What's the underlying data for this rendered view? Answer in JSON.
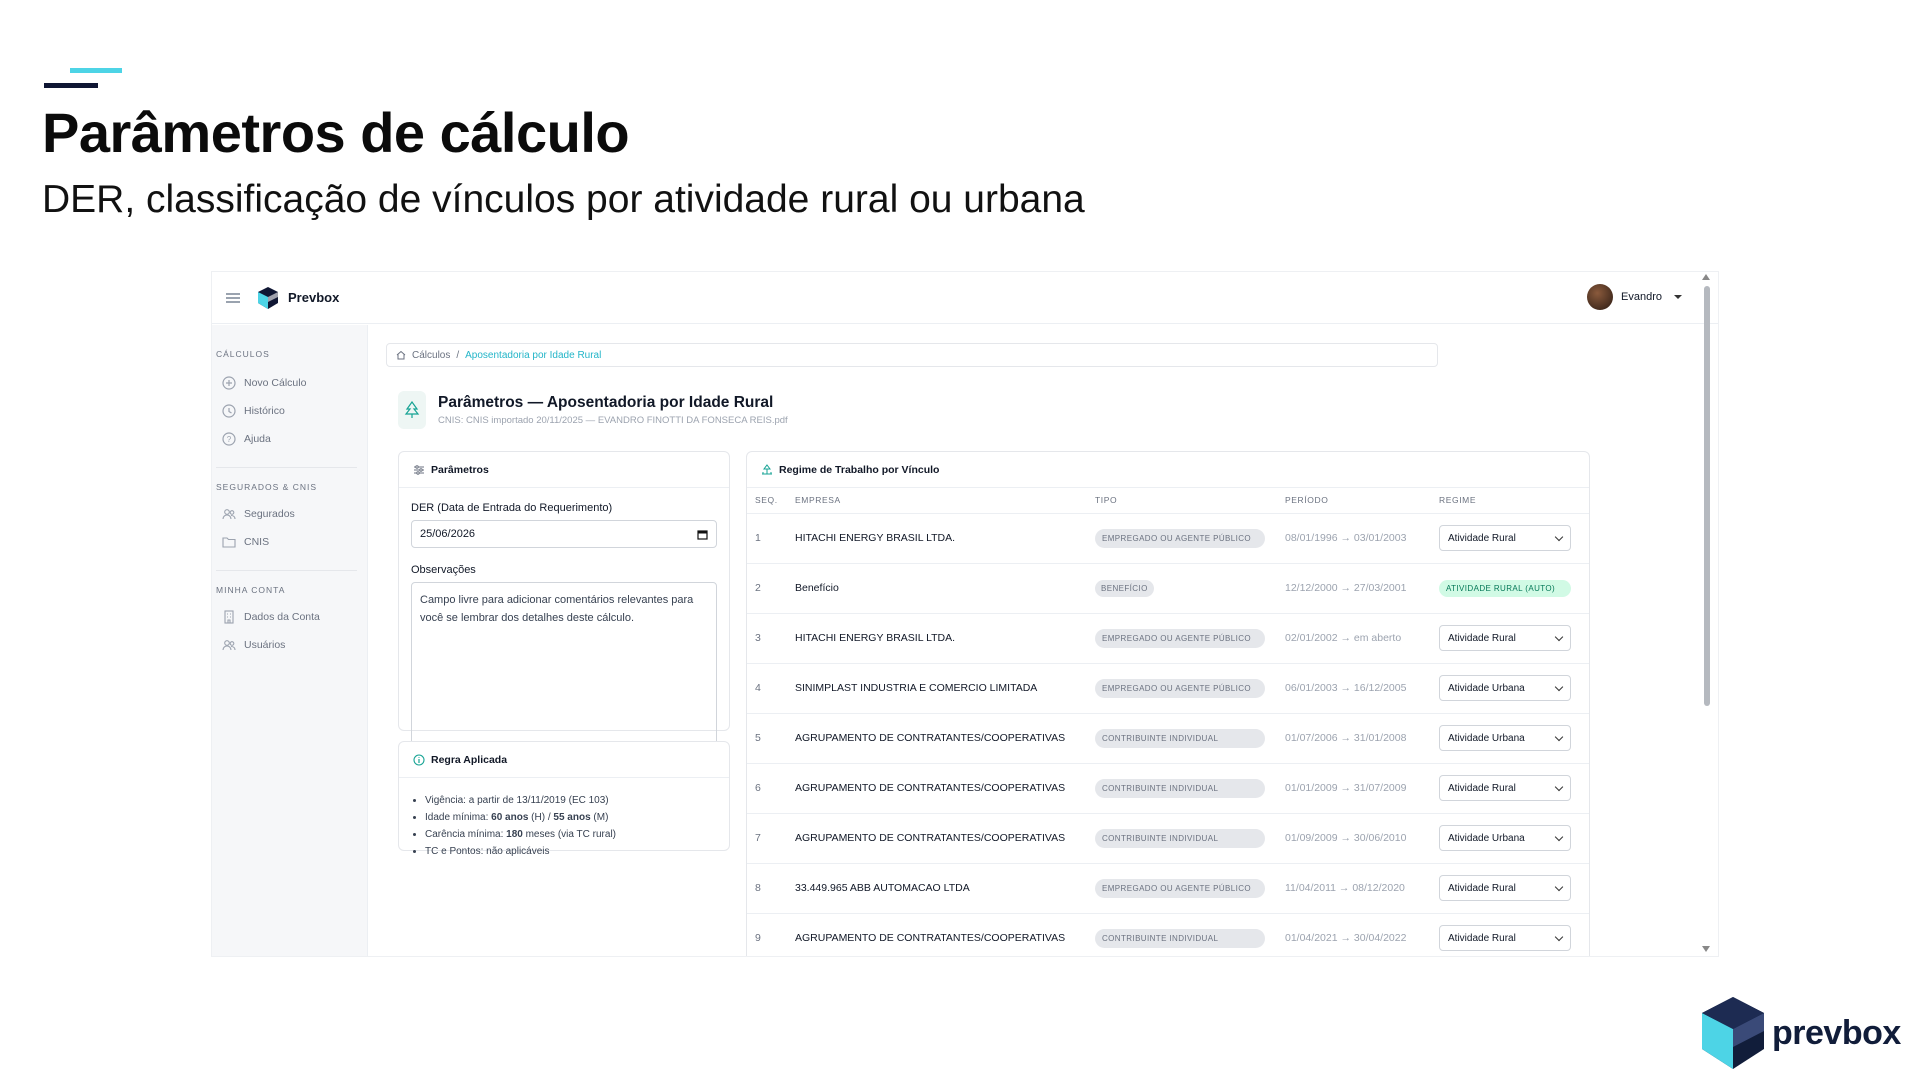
{
  "slide": {
    "title": "Parâmetros de cálculo",
    "subtitle": "DER, classificação de vínculos por atividade rural ou urbana",
    "logo_text": "prevbox"
  },
  "colors": {
    "accent": "#4dd4e6",
    "navy": "#0f1633",
    "teal_link": "#23b5c8",
    "auto_green_bg": "#d1fae5"
  },
  "app": {
    "brand": "Prevbox",
    "user": {
      "name": "Evandro"
    }
  },
  "sidebar": {
    "sections": [
      {
        "title": "CÁLCULOS",
        "items": [
          {
            "label": "Novo Cálculo",
            "icon": "plus-circle-icon"
          },
          {
            "label": "Histórico",
            "icon": "clock-icon"
          },
          {
            "label": "Ajuda",
            "icon": "help-icon"
          }
        ]
      },
      {
        "title": "SEGURADOS & CNIS",
        "items": [
          {
            "label": "Segurados",
            "icon": "users-icon"
          },
          {
            "label": "CNIS",
            "icon": "folder-icon"
          }
        ]
      },
      {
        "title": "MINHA CONTA",
        "items": [
          {
            "label": "Dados da Conta",
            "icon": "building-icon"
          },
          {
            "label": "Usuários",
            "icon": "users-icon"
          }
        ]
      }
    ]
  },
  "breadcrumb": {
    "root": "Cálculos",
    "separator": "/",
    "current": "Aposentadoria por Idade Rural"
  },
  "page": {
    "title": "Parâmetros — Aposentadoria por Idade Rural",
    "subtitle": "CNIS: CNIS importado 20/11/2025 — EVANDRO FINOTTI DA FONSECA REIS.pdf"
  },
  "params_card": {
    "title": "Parâmetros",
    "der_label": "DER (Data de Entrada do Requerimento)",
    "der_value": "25/06/2026",
    "obs_label": "Observações",
    "obs_placeholder": "Campo livre para adicionar comentários relevantes para você se lembrar dos detalhes deste cálculo."
  },
  "rule_card": {
    "title": "Regra Aplicada",
    "items": [
      {
        "prefix": "Vigência: a partir de 13/11/2019 (EC 103)",
        "strong1": "",
        "mid": "",
        "strong2": "",
        "suffix": ""
      },
      {
        "prefix": "Idade mínima: ",
        "strong1": "60 anos",
        "mid": " (H) / ",
        "strong2": "55 anos",
        "suffix": " (M)"
      },
      {
        "prefix": "Carência mínima: ",
        "strong1": "180",
        "mid": " meses (via TC rural)",
        "strong2": "",
        "suffix": ""
      },
      {
        "prefix": "TC e Pontos: não aplicáveis",
        "strong1": "",
        "mid": "",
        "strong2": "",
        "suffix": ""
      }
    ]
  },
  "vinculos": {
    "title": "Regime de Trabalho por Vínculo",
    "columns": [
      "SEQ.",
      "EMPRESA",
      "TIPO",
      "PERÍODO",
      "REGIME"
    ],
    "rows": [
      {
        "seq": "1",
        "empresa": "HITACHI ENERGY BRASIL LTDA.",
        "tipo": "EMPREGADO OU AGENTE PÚBLICO",
        "periodo": "08/01/1996 → 03/01/2003",
        "regime": "Atividade Rural",
        "auto": false
      },
      {
        "seq": "2",
        "empresa": "Benefício",
        "tipo": "BENEFÍCIO",
        "periodo": "12/12/2000 → 27/03/2001",
        "regime": "ATIVIDADE RURAL (AUTO)",
        "auto": true
      },
      {
        "seq": "3",
        "empresa": "HITACHI ENERGY BRASIL LTDA.",
        "tipo": "EMPREGADO OU AGENTE PÚBLICO",
        "periodo": "02/01/2002 → em aberto",
        "regime": "Atividade Rural",
        "auto": false
      },
      {
        "seq": "4",
        "empresa": "SINIMPLAST INDUSTRIA E COMERCIO LIMITADA",
        "tipo": "EMPREGADO OU AGENTE PÚBLICO",
        "periodo": "06/01/2003 → 16/12/2005",
        "regime": "Atividade Urbana",
        "auto": false
      },
      {
        "seq": "5",
        "empresa": "AGRUPAMENTO DE CONTRATANTES/COOPERATIVAS",
        "tipo": "CONTRIBUINTE INDIVIDUAL",
        "periodo": "01/07/2006 → 31/01/2008",
        "regime": "Atividade Urbana",
        "auto": false
      },
      {
        "seq": "6",
        "empresa": "AGRUPAMENTO DE CONTRATANTES/COOPERATIVAS",
        "tipo": "CONTRIBUINTE INDIVIDUAL",
        "periodo": "01/01/2009 → 31/07/2009",
        "regime": "Atividade Rural",
        "auto": false
      },
      {
        "seq": "7",
        "empresa": "AGRUPAMENTO DE CONTRATANTES/COOPERATIVAS",
        "tipo": "CONTRIBUINTE INDIVIDUAL",
        "periodo": "01/09/2009 → 30/06/2010",
        "regime": "Atividade Urbana",
        "auto": false
      },
      {
        "seq": "8",
        "empresa": "33.449.965 ABB AUTOMACAO LTDA",
        "tipo": "EMPREGADO OU AGENTE PÚBLICO",
        "periodo": "11/04/2011 → 08/12/2020",
        "regime": "Atividade Rural",
        "auto": false
      },
      {
        "seq": "9",
        "empresa": "AGRUPAMENTO DE CONTRATANTES/COOPERATIVAS",
        "tipo": "CONTRIBUINTE INDIVIDUAL",
        "periodo": "01/04/2021 → 30/04/2022",
        "regime": "Atividade Rural",
        "auto": false
      }
    ]
  }
}
